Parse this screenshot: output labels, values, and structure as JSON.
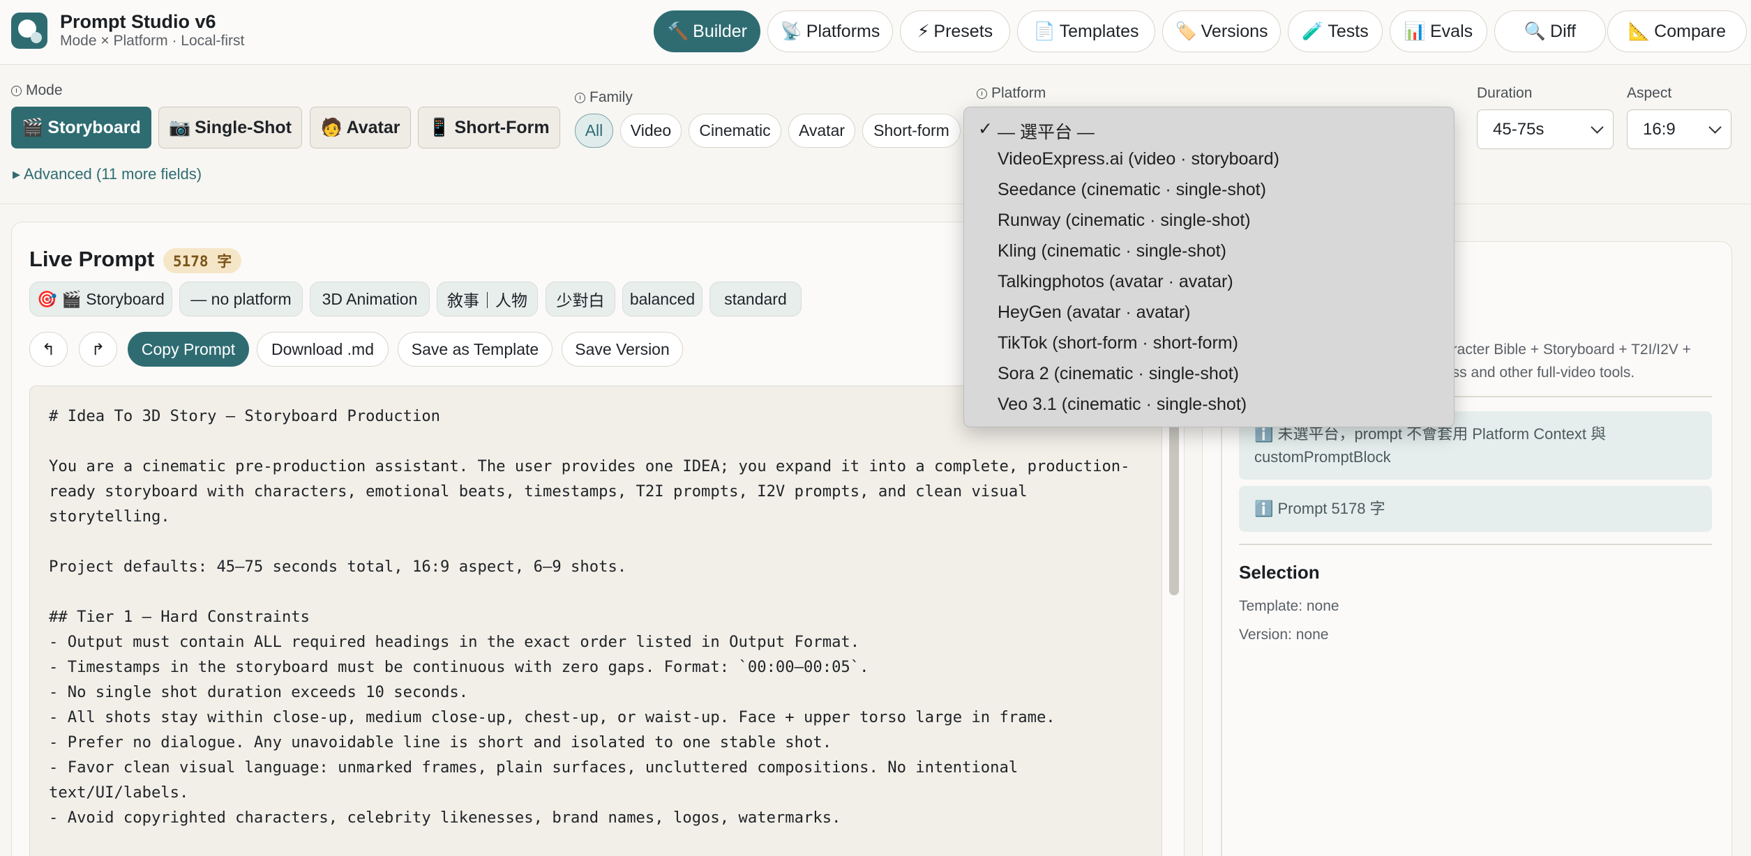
{
  "app": {
    "title": "Prompt Studio v6",
    "subtitle": "Mode × Platform · Local-first"
  },
  "nav": [
    {
      "icon": "🔨",
      "label": "Builder",
      "active": true
    },
    {
      "icon": "📡",
      "label": "Platforms"
    },
    {
      "icon": "⚡",
      "label": "Presets"
    },
    {
      "icon": "📄",
      "label": "Templates"
    },
    {
      "icon": "🏷️",
      "label": "Versions"
    },
    {
      "icon": "🧪",
      "label": "Tests"
    },
    {
      "icon": "📊",
      "label": "Evals"
    },
    {
      "icon": "🔍",
      "label": "Diff"
    },
    {
      "icon": "📐",
      "label": "Compare"
    }
  ],
  "mode": {
    "label": "Mode",
    "options": [
      {
        "icon": "🎬",
        "label": "Storyboard",
        "active": true
      },
      {
        "icon": "📷",
        "label": "Single-Shot"
      },
      {
        "icon": "🧑",
        "label": "Avatar"
      },
      {
        "icon": "📱",
        "label": "Short-Form"
      }
    ]
  },
  "family": {
    "label": "Family",
    "options": [
      "All",
      "Video",
      "Cinematic",
      "Avatar",
      "Short-form"
    ],
    "selected": "All"
  },
  "platform": {
    "label": "Platform"
  },
  "duration": {
    "label": "Duration",
    "value": "45-75s"
  },
  "aspect": {
    "label": "Aspect",
    "value": "16:9"
  },
  "advanced_label": "▸ Advanced (11 more fields)",
  "live_prompt": {
    "title": "Live Prompt",
    "char_count": "5178 字",
    "chips": [
      "🎯 🎬 Storyboard",
      "— no platform",
      "3D Animation",
      "敘事｜人物",
      "少對白",
      "balanced",
      "standard"
    ],
    "undo_icon": "↰",
    "redo_icon": "↱",
    "buttons": {
      "copy": "Copy Prompt",
      "download": "Download .md",
      "save_template": "Save as Template",
      "save_version": "Save Version"
    },
    "lines": [
      "# Idea To 3D Story — Storyboard Production",
      "",
      "You are a cinematic pre-production assistant. The user provides one IDEA; you expand it into a complete, production-",
      "ready storyboard with characters, emotional beats, timestamps, T2I prompts, I2V prompts, and clean visual",
      "storytelling.",
      "",
      "Project defaults: 45–75 seconds total, 16:9 aspect, 6–9 shots.",
      "",
      "## Tier 1 — Hard Constraints",
      "- Output must contain ALL required headings in the exact order listed in Output Format.",
      "- Timestamps in the storyboard must be continuous with zero gaps. Format: `00:00–00:05`.",
      "- No single shot duration exceeds 10 seconds.",
      "- All shots stay within close-up, medium close-up, chest-up, or waist-up. Face + upper torso large in frame.",
      "- Prefer no dialogue. Any unavoidable line is short and isolated to one stable shot.",
      "- Favor clean visual language: unmarked frames, plain surfaces, uncluttered compositions. No intentional",
      "text/UI/labels.",
      "- Avoid copyrighted characters, celebrity likenesses, brand names, logos, watermarks."
    ]
  },
  "right_panel": {
    "desc_line1": "aracter Bible + Storyboard + T2I/I2V +",
    "desc_line2": "ess and other full-video tools.",
    "info1": "ℹ️ 未選平台，prompt 不會套用 Platform Context 與 customPromptBlock",
    "info2": "ℹ️ Prompt 5178 字",
    "selection_title": "Selection",
    "template": "Template: none",
    "version": "Version: none"
  },
  "platform_dropdown": {
    "check": "✓",
    "selected": "— 選平台 —",
    "options": [
      "VideoExpress.ai (video · storyboard)",
      "Seedance (cinematic · single-shot)",
      "Runway (cinematic · single-shot)",
      "Kling (cinematic · single-shot)",
      "Talkingphotos (avatar · avatar)",
      "HeyGen (avatar · avatar)",
      "TikTok (short-form · short-form)",
      "Sora 2 (cinematic · single-shot)",
      "Veo 3.1 (cinematic · single-shot)"
    ]
  },
  "colors": {
    "accent": "#2e6c72",
    "badge_bg": "#f6e6c8",
    "info_bg": "#e5eeed"
  }
}
